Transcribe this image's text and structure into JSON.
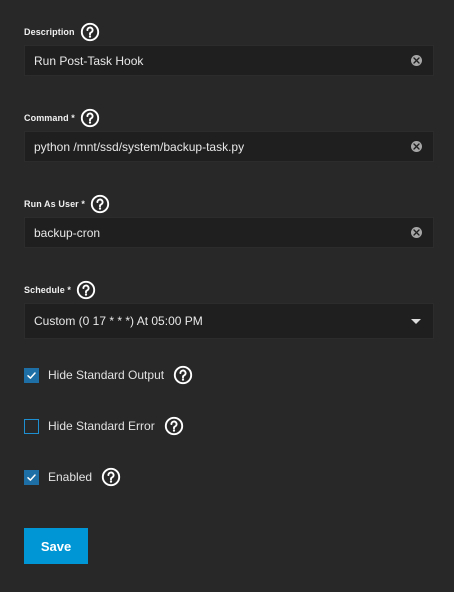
{
  "form": {
    "description": {
      "label": "Description",
      "value": "Run Post-Task Hook"
    },
    "command": {
      "label": "Command *",
      "value": "python /mnt/ssd/system/backup-task.py"
    },
    "run_as_user": {
      "label": "Run As User *",
      "value": "backup-cron"
    },
    "schedule": {
      "label": "Schedule *",
      "value": "Custom (0 17 * * *) At 05:00 PM"
    },
    "hide_standard_output": {
      "label": "Hide Standard Output",
      "checked": true
    },
    "hide_standard_error": {
      "label": "Hide Standard Error",
      "checked": false
    },
    "enabled": {
      "label": "Enabled",
      "checked": true
    },
    "save_label": "Save"
  },
  "icons": {
    "help": "help-circle-icon",
    "clear": "clear-icon",
    "dropdown": "caret-down-icon",
    "check": "check-icon"
  },
  "colors": {
    "background": "#282828",
    "input_background": "#1f1f1f",
    "accent": "#0095d5",
    "checkbox_fill": "#1d6fa5"
  }
}
